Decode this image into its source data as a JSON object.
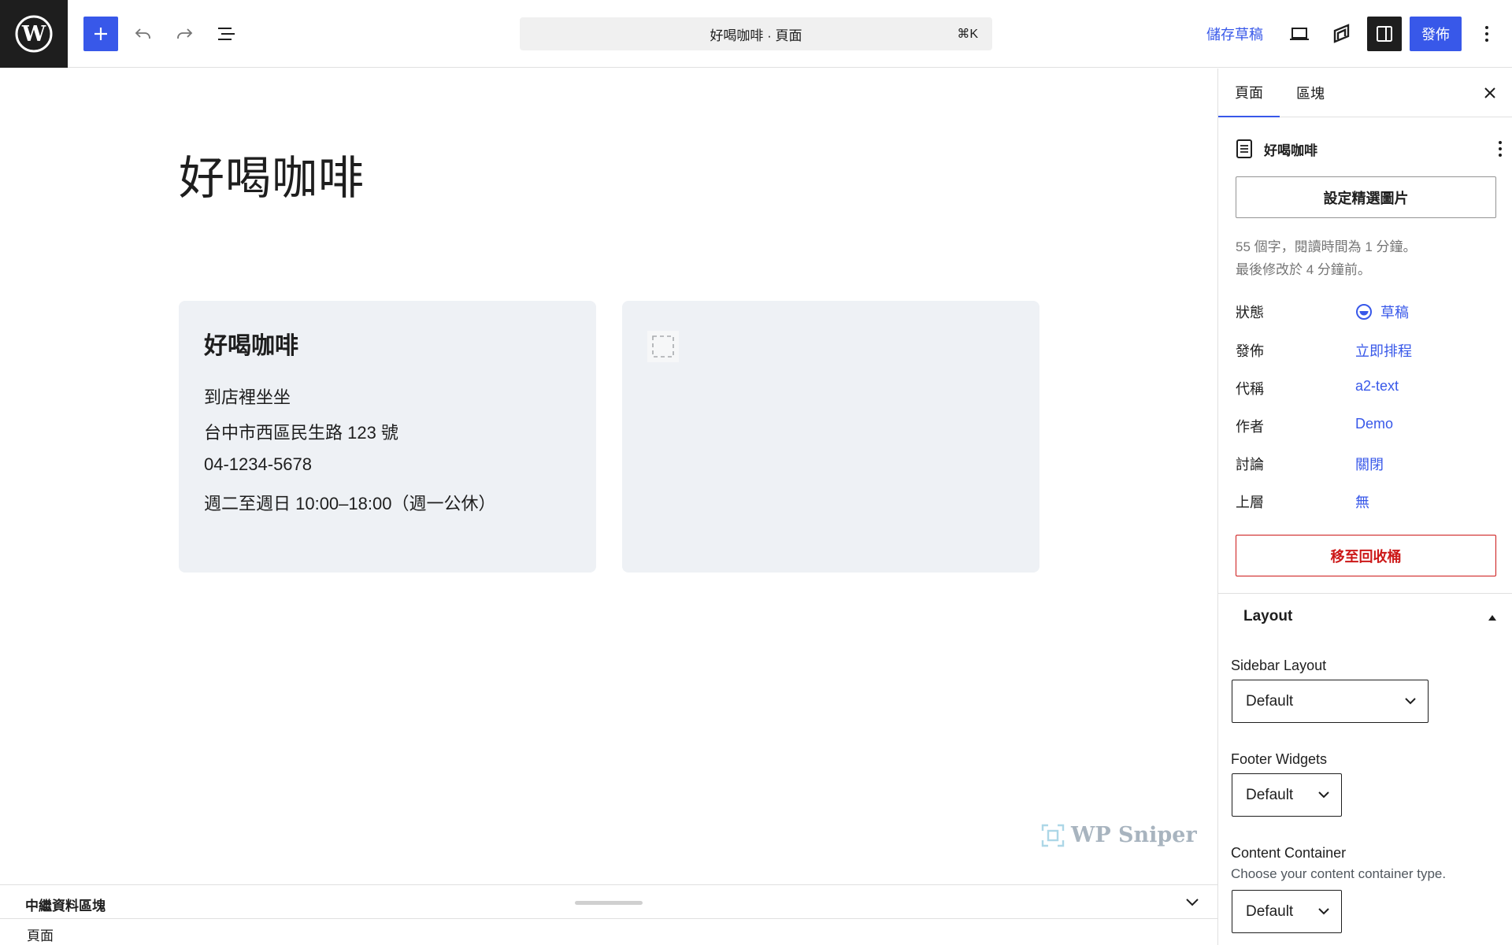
{
  "toolbar": {
    "document_title": "好喝咖啡 · 頁面",
    "shortcut": "⌘K",
    "save_draft_label": "儲存草稿",
    "publish_label": "發佈",
    "accent": "#3858e9"
  },
  "editor": {
    "post_title": "好喝咖啡",
    "card": {
      "title": "好喝咖啡",
      "lines": [
        "到店裡坐坐",
        "台中市西區民生路 123 號",
        "04-1234-5678",
        "週二至週日 10:00–18:00（週一公休）"
      ]
    },
    "watermark": "WP Sniper"
  },
  "metabox": {
    "title": "中繼資料區塊",
    "breadcrumb": "頁面"
  },
  "sidebar": {
    "tabs": [
      "頁面",
      "區塊"
    ],
    "doc_title": "好喝咖啡",
    "featured_image_button": "設定精選圖片",
    "word_count_text": "55 個字，閱讀時間為 1 分鐘。",
    "last_modified_text": "最後修改於 4 分鐘前。",
    "rows": [
      {
        "label": "狀態",
        "value": "草稿"
      },
      {
        "label": "發佈",
        "value": "立即排程"
      },
      {
        "label": "代稱",
        "value": "a2-text"
      },
      {
        "label": "作者",
        "value": "Demo"
      },
      {
        "label": "討論",
        "value": "關閉"
      },
      {
        "label": "上層",
        "value": "無"
      }
    ],
    "trash_button": "移至回收桶",
    "layout": {
      "title": "Layout",
      "sidebar_layout_label": "Sidebar Layout",
      "sidebar_layout_value": "Default",
      "footer_widgets_label": "Footer Widgets",
      "footer_widgets_value": "Default",
      "content_container_label": "Content Container",
      "content_container_help": "Choose your content container type.",
      "content_container_value": "Default"
    }
  },
  "icons": {
    "wp_logo": "wordpress-logo-icon",
    "inserter": "plus-icon",
    "undo": "undo-icon",
    "redo": "redo-icon",
    "outline": "list-view-icon",
    "preview": "desktop-icon",
    "jetpack": "jetpack-icon",
    "settings": "sidebar-icon",
    "options": "more-vertical-icon",
    "close": "close-icon",
    "page": "page-icon",
    "status": "draft-status-icon",
    "chevron": "chevron-down-icon"
  }
}
